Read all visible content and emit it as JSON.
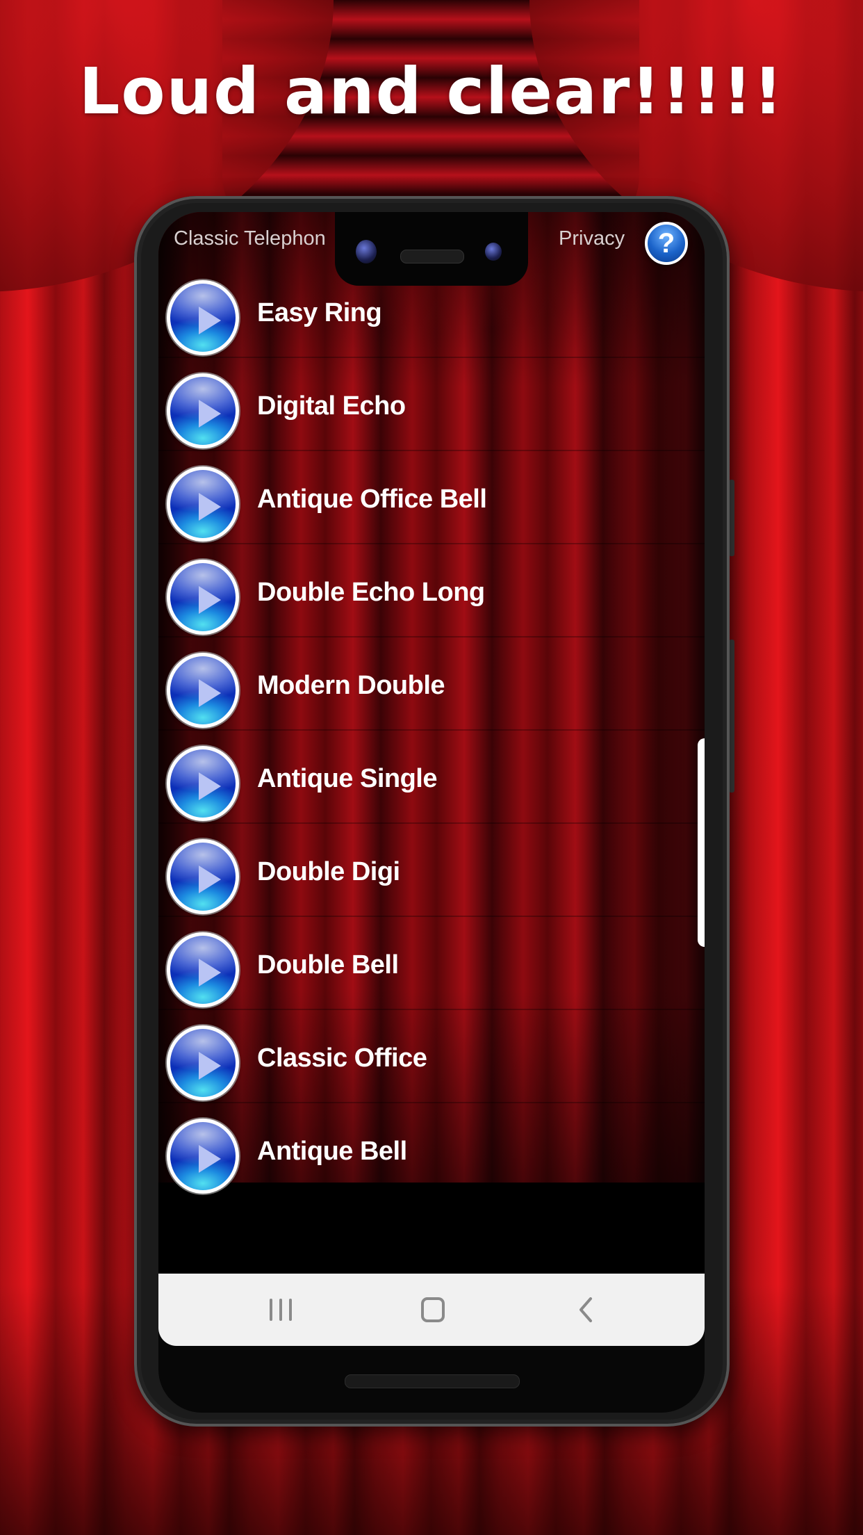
{
  "promo": {
    "headline": "Loud and clear!!!!!"
  },
  "app": {
    "title": "Classic Telephon",
    "privacy_label": "Privacy",
    "help_icon": "question-mark-icon",
    "help_glyph": "?"
  },
  "ringtones": [
    {
      "label": "Easy Ring",
      "icon": "play-icon"
    },
    {
      "label": "Digital Echo",
      "icon": "play-icon"
    },
    {
      "label": "Antique Office Bell",
      "icon": "play-icon"
    },
    {
      "label": "Double Echo Long",
      "icon": "play-icon"
    },
    {
      "label": "Modern Double",
      "icon": "play-icon"
    },
    {
      "label": "Antique Single",
      "icon": "play-icon"
    },
    {
      "label": "Double Digi",
      "icon": "play-icon"
    },
    {
      "label": "Double Bell",
      "icon": "play-icon"
    },
    {
      "label": "Classic Office",
      "icon": "play-icon"
    },
    {
      "label": "Antique Bell",
      "icon": "play-icon"
    }
  ],
  "system_nav": {
    "recents": "recents-icon",
    "home": "home-icon",
    "back": "back-icon"
  },
  "colors": {
    "curtain_red": "#c81217",
    "play_button_blue": "#0b2fb8",
    "nav_bar_bg": "#f1f1f1"
  }
}
